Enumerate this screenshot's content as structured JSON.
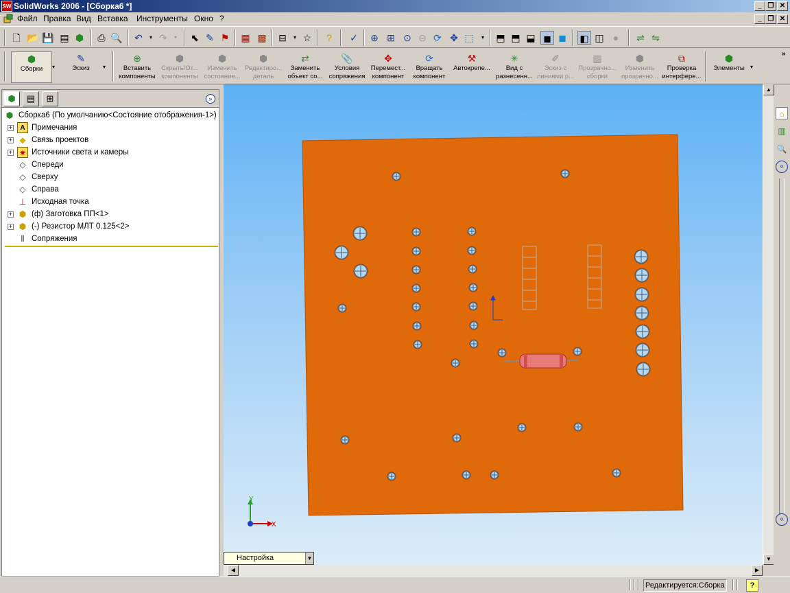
{
  "window": {
    "title": "SolidWorks 2006 - [Сборка6 *]",
    "app_icon": "SW"
  },
  "menu": [
    "Файл",
    "Правка",
    "Вид",
    "Вставка",
    "Инструменты",
    "Окно",
    "?"
  ],
  "commands": [
    {
      "label": "Сборки",
      "enabled": true,
      "icon": "assembly-icon"
    },
    {
      "label": "Эскиз",
      "enabled": true,
      "icon": "sketch-icon"
    },
    {
      "label": "Вставить компоненты",
      "enabled": true,
      "icon": "insert-component-icon"
    },
    {
      "label": "Скрыть/От... компоненты",
      "enabled": false,
      "icon": "hide-show-icon"
    },
    {
      "label": "Изменить состояние...",
      "enabled": false,
      "icon": "change-state-icon"
    },
    {
      "label": "Редактиро... деталь",
      "enabled": false,
      "icon": "edit-part-icon"
    },
    {
      "label": "Заменить объект со...",
      "enabled": true,
      "icon": "replace-icon"
    },
    {
      "label": "Условия сопряжения",
      "enabled": true,
      "icon": "mate-icon"
    },
    {
      "label": "Перемест... компонент",
      "enabled": true,
      "icon": "move-icon"
    },
    {
      "label": "Вращать компонент",
      "enabled": true,
      "icon": "rotate-icon"
    },
    {
      "label": "Автокрепе...",
      "enabled": true,
      "icon": "smart-fastener-icon"
    },
    {
      "label": "Вид с разнесенн...",
      "enabled": true,
      "icon": "explode-icon"
    },
    {
      "label": "Эскиз с линиями р...",
      "enabled": false,
      "icon": "explode-line-icon"
    },
    {
      "label": "Прозрачно... сборки",
      "enabled": false,
      "icon": "transparency-icon"
    },
    {
      "label": "Изменить прозрачно...",
      "enabled": false,
      "icon": "change-transparency-icon"
    },
    {
      "label": "Проверка интерфере...",
      "enabled": true,
      "icon": "interference-icon"
    },
    {
      "label": "Элементы",
      "enabled": true,
      "icon": "features-icon"
    }
  ],
  "tree": {
    "root": "Сборка6  (По умолчанию<Состояние отображения-1>)",
    "items": [
      {
        "label": "Примечания",
        "expandable": true,
        "icon": "annotations-icon"
      },
      {
        "label": "Связь проектов",
        "expandable": true,
        "icon": "design-binder-icon"
      },
      {
        "label": "Источники света и камеры",
        "expandable": true,
        "icon": "lights-icon"
      },
      {
        "label": "Спереди",
        "expandable": false,
        "icon": "plane-icon"
      },
      {
        "label": "Сверху",
        "expandable": false,
        "icon": "plane-icon"
      },
      {
        "label": "Справа",
        "expandable": false,
        "icon": "plane-icon"
      },
      {
        "label": "Исходная точка",
        "expandable": false,
        "icon": "origin-icon"
      },
      {
        "label": "(ф) Заготовка ПП<1>",
        "expandable": true,
        "icon": "part-icon"
      },
      {
        "label": "(-) Резистор МЛТ 0.125<2>",
        "expandable": true,
        "icon": "part-icon"
      },
      {
        "label": "Сопряжения",
        "expandable": false,
        "icon": "mates-icon"
      }
    ]
  },
  "viewport": {
    "board_color": "#e0690a",
    "background": "#5db1f5",
    "triad": {
      "x_label": "X",
      "y_label": "Y"
    },
    "configuration": "Настройка"
  },
  "status": {
    "text": "Редактируется:Сборка",
    "help": "?"
  },
  "colors": {
    "accent": "#0a246a",
    "board": "#e0690a",
    "resistor": "#e87a7a"
  }
}
